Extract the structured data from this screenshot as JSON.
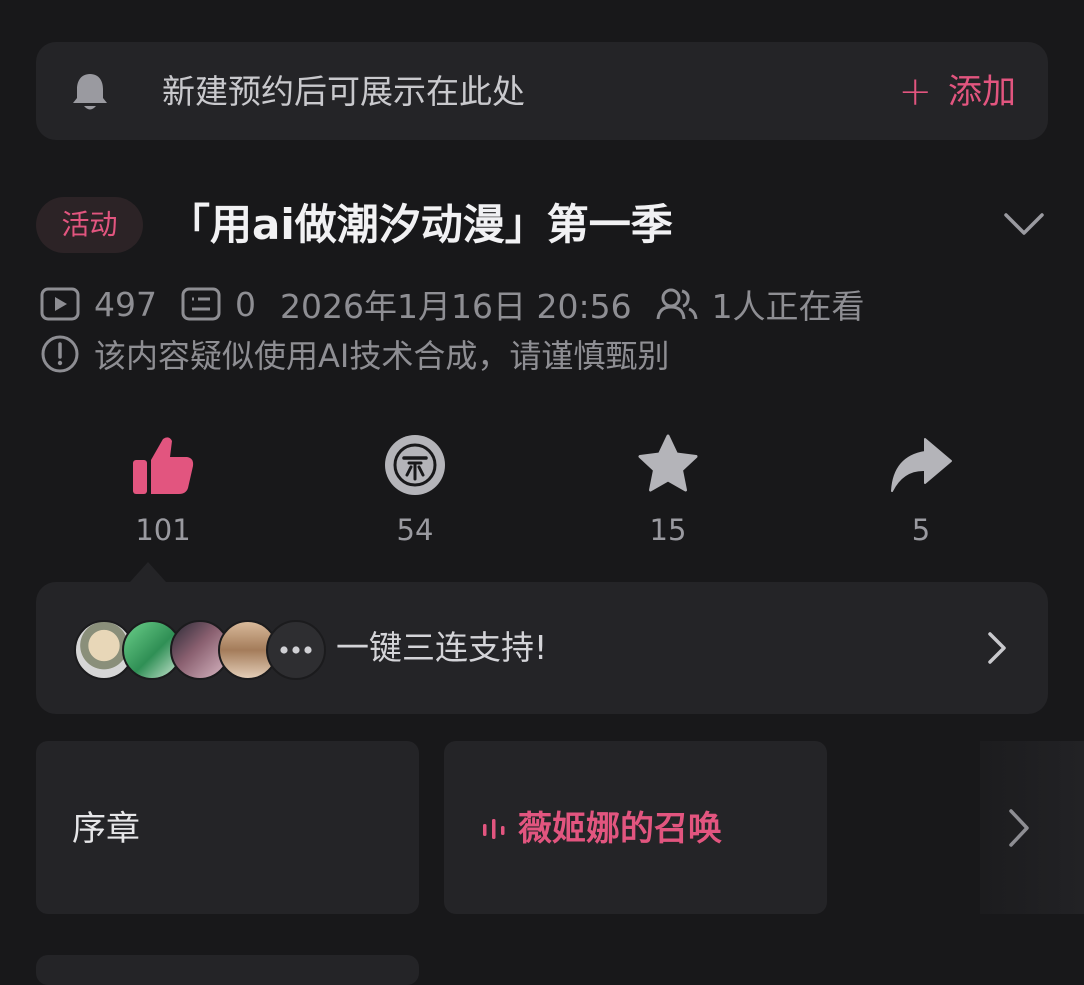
{
  "reminder": {
    "text": "新建预约后可展示在此处",
    "add_label": "添加",
    "add_symbol": "+"
  },
  "video": {
    "badge": "活动",
    "title": "「用ai做潮汐动漫」第一季",
    "views": "497",
    "comments": "0",
    "datetime": "2026年1月16日 20:56",
    "watching": "1人正在看",
    "notice": "该内容疑似使用AI技术合成，请谨慎甄别"
  },
  "actions": [
    {
      "name": "like",
      "count": "101",
      "icon": "thumbs-up-icon"
    },
    {
      "name": "coin",
      "count": "54",
      "icon": "coin-icon"
    },
    {
      "name": "favorite",
      "count": "15",
      "icon": "star-icon"
    },
    {
      "name": "share",
      "count": "5",
      "icon": "share-icon"
    }
  ],
  "triple": {
    "text": "一键三连支持!"
  },
  "episodes": [
    {
      "label": "序章",
      "current": false
    },
    {
      "label": "薇姬娜的召唤",
      "current": true
    }
  ],
  "colors": {
    "accent": "#e2557f",
    "background": "#18181a",
    "card": "#242427"
  }
}
